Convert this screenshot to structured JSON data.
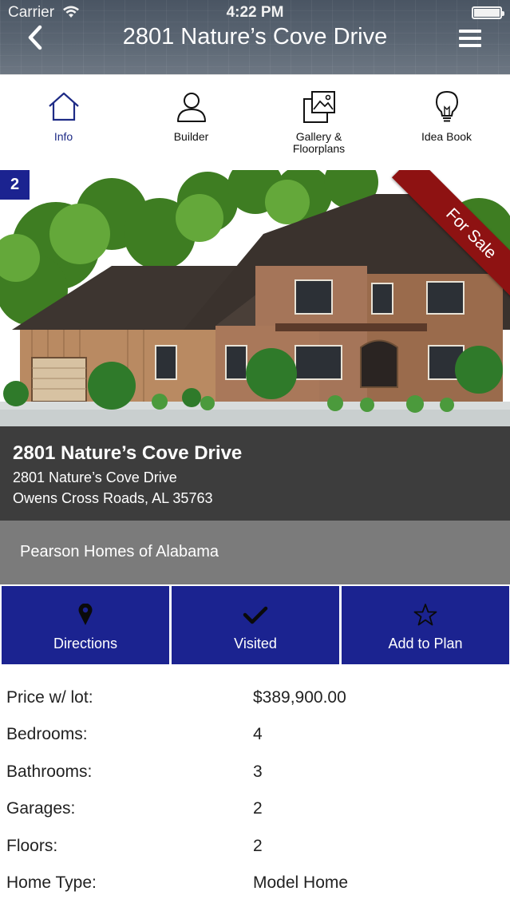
{
  "status_bar": {
    "carrier": "Carrier",
    "time": "4:22 PM"
  },
  "header": {
    "title": "2801 Nature’s Cove Drive"
  },
  "tabs": [
    {
      "label": "Info",
      "icon": "house-icon",
      "active": true
    },
    {
      "label": "Builder",
      "icon": "person-icon",
      "active": false
    },
    {
      "label": "Gallery &\nFloorplans",
      "label_line1": "Gallery &",
      "label_line2": "Floorplans",
      "icon": "gallery-icon",
      "active": false
    },
    {
      "label": "Idea Book",
      "icon": "lightbulb-icon",
      "active": false
    }
  ],
  "hero": {
    "badge_number": "2",
    "ribbon_text": "For Sale"
  },
  "address": {
    "title": "2801 Nature’s Cove Drive",
    "line1": "2801 Nature’s Cove Drive",
    "line2": "Owens Cross Roads, AL 35763"
  },
  "builder": {
    "name": "Pearson Homes of Alabama"
  },
  "actions": [
    {
      "label": "Directions",
      "icon": "map-pin-icon"
    },
    {
      "label": "Visited",
      "icon": "checkmark-icon"
    },
    {
      "label": "Add to Plan",
      "icon": "star-outline-icon"
    }
  ],
  "details": [
    {
      "label": "Price w/ lot:",
      "value": "$389,900.00"
    },
    {
      "label": "Bedrooms:",
      "value": "4"
    },
    {
      "label": "Bathrooms:",
      "value": "3"
    },
    {
      "label": "Garages:",
      "value": "2"
    },
    {
      "label": "Floors:",
      "value": "2"
    },
    {
      "label": "Home Type:",
      "value": "Model Home"
    }
  ],
  "colors": {
    "brand_blue": "#1b2390",
    "active_tab_text": "#1e2b86",
    "ribbon_red": "#8e1212",
    "address_bg": "#3d3d3d",
    "builder_bg": "#7b7b7b"
  }
}
